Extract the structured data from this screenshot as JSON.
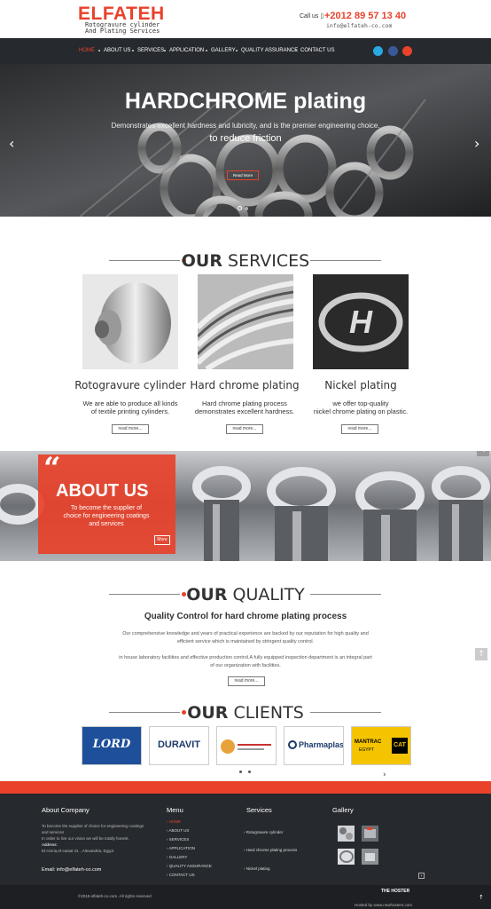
{
  "brand": {
    "name": "ELFATEH",
    "tagline_line1": "Rotogravure cylinder",
    "tagline_line2": "And Plating Services",
    "color": "#e8422b"
  },
  "contact": {
    "call_label": "Call us",
    "phone": "+2012 89 57 13 40",
    "email": "info@elfateh-co.com"
  },
  "nav": {
    "items": [
      "HOME",
      "ABOUT US",
      "SERVICES",
      "APPLICATION",
      "GALLERY",
      "QUALITY ASSURANCE",
      "CONTACT US"
    ],
    "active": "HOME"
  },
  "social": [
    "twitter-icon",
    "facebook-icon",
    "instagram-icon"
  ],
  "hero": {
    "title": "HARDCHROME plating",
    "subtitle1": "Demonstrates excellent hardness and lubricity, and is the premier engineering choice.",
    "subtitle2": "to reduce friction",
    "button": "Read More"
  },
  "services": {
    "heading_bold": "OUR",
    "heading_rest": " SERVICES",
    "items": [
      {
        "title": "Rotogravure cylinder",
        "desc1": "We are able to produce all kinds",
        "desc2": "of textile printing cylinders.",
        "button": "read more..."
      },
      {
        "title": "Hard chrome plating",
        "desc1": "Hard chrome plating process",
        "desc2": "demonstrates excellent hardness.",
        "button": "read more..."
      },
      {
        "title": "Nickel plating",
        "desc1": "we offer top-quality",
        "desc2": "nickel chrome plating on plastic.",
        "button": "read more..."
      }
    ]
  },
  "about": {
    "quote": "“",
    "title": "ABOUT US",
    "text1": "To become the supplier of",
    "text2": "choice for engineering coatings",
    "text3": "and services",
    "button": "More"
  },
  "quality": {
    "heading_bold": "OUR",
    "heading_rest": " QUALITY",
    "subtitle": "Quality Control for hard chrome plating process",
    "p1a": "Our comprehensive knowledge and years of practical experience are backed by our reputation for high quality and",
    "p1b": "efficient service which is maintained by stringent quality control.",
    "p2a": "in house laboratory facilities and effective production control.A fully equipped inspection department is an integral part",
    "p2b": "of our organization with facilities.",
    "button": "read more..."
  },
  "clients": {
    "heading_bold": "OUR",
    "heading_rest": " CLIENTS",
    "logos": [
      {
        "text": "LORD",
        "sub": ""
      },
      {
        "text": "DURAVIT",
        "sub": ""
      },
      {
        "text": "",
        "sub": ""
      },
      {
        "text": "Pharmaplast",
        "sub": ""
      },
      {
        "text": "MANTRAC",
        "sub": "EGYPT",
        "cat": "CAT"
      }
    ],
    "next": "›"
  },
  "footer": {
    "about_head": "About Company",
    "about_text1": "To become the supplier of choice for engineering coatings",
    "about_text2": "and services",
    "about_text3": "In order to live our vision we will be totally honest.",
    "address_label": "Address:",
    "address": "El-Amria,el-castat St. , Alexandria, Egypt",
    "email_label": "Email:",
    "email": "info@elfateh-co.com",
    "menu_head": "Menu",
    "menu": [
      "HOME",
      "ABOUT US",
      "SERVICES",
      "APPLICATION",
      "GALLERY",
      "QUALITY ASSURANCE",
      "CONTACT US"
    ],
    "services_head": "Services",
    "services": [
      "Rotogravure cylinder",
      "Hard chrome plating process",
      "Nickel plating"
    ],
    "gallery_head": "Gallery",
    "copyright": "©2018 elfateh-co.com .All rights reserved",
    "hosted": "Hosted by www.newhosters.com",
    "hoster_logo": "THE HOSTER"
  }
}
